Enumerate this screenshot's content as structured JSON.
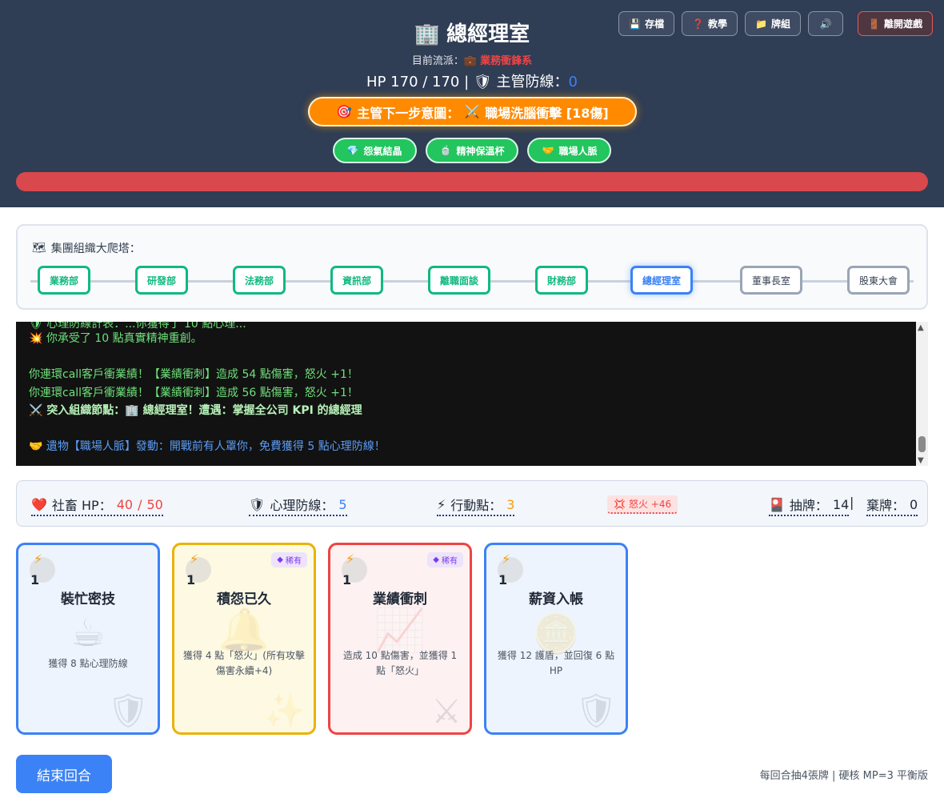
{
  "toolbar": {
    "save": {
      "icon": "💾",
      "label": "存檔"
    },
    "tutorial": {
      "icon": "❓",
      "label": "教學"
    },
    "deck": {
      "icon": "📁",
      "label": "牌組"
    },
    "sound": {
      "icon": "🔊"
    },
    "leave": {
      "icon": "🚪",
      "label": "離開遊戲"
    }
  },
  "enemy": {
    "icon": "🏢",
    "name": "總經理室",
    "faction_label": "目前流派：",
    "faction_icon": "💼",
    "faction_value": "業務衝鋒系",
    "hp_text": "HP 170 / 170 |",
    "shield_icon": "🛡",
    "defense_label": "主管防線：",
    "defense_value": "0",
    "hp_fraction": 1.0,
    "intent": {
      "icon": "🎯",
      "label": "主管下一步意圖：",
      "attack_icon": "⚔️",
      "value": "職場洗腦衝擊 [18傷]"
    },
    "relics": [
      {
        "icon": "💎",
        "label": "怨氣結晶"
      },
      {
        "icon": "🍵",
        "label": "精神保溫杯"
      },
      {
        "icon": "🤝",
        "label": "職場人脈"
      }
    ]
  },
  "map": {
    "icon": "🗺",
    "title": "集團組織大爬塔：",
    "nodes": [
      {
        "label": "業務部",
        "state": "cleared"
      },
      {
        "label": "研發部",
        "state": "cleared"
      },
      {
        "label": "法務部",
        "state": "cleared"
      },
      {
        "label": "資訊部",
        "state": "cleared"
      },
      {
        "label": "離職面談",
        "state": "cleared"
      },
      {
        "label": "財務部",
        "state": "cleared"
      },
      {
        "label": "總經理室",
        "state": "current"
      },
      {
        "label": "董事長室",
        "state": "locked"
      },
      {
        "label": "股東大會",
        "state": "locked"
      }
    ]
  },
  "log": {
    "partial_top": "🛡 心理防線計表：...你獲得了 10 點心理...",
    "lines": [
      {
        "icon": "💥",
        "text": "你承受了 10 點真實精神重創。"
      },
      {
        "icon": "",
        "text": "你連環call客戶衝業績！【業績衝刺】造成 54 點傷害，怒火 +1！"
      },
      {
        "icon": "",
        "text": "你連環call客戶衝業績！【業績衝刺】造成 56 點傷害，怒火 +1！"
      },
      {
        "icon": "⚔️",
        "text": "突入組織節點：🏢 總經理室！遭遇：掌握全公司 KPI 的總經理"
      },
      {
        "icon": "🤝",
        "text": "遺物【職場人脈】發動：開戰前有人罩你，免費獲得 5 點心理防線！"
      }
    ]
  },
  "player": {
    "hp": {
      "icon": "❤️",
      "label": "社畜 HP：",
      "current": "40",
      "sep": " / ",
      "max": "50"
    },
    "defense": {
      "icon": "🛡",
      "label": "心理防線：",
      "value": "5"
    },
    "action": {
      "icon": "⚡",
      "label": "行動點：",
      "value": "3"
    },
    "rage": {
      "icon": "💢",
      "label": "怒火 +46"
    },
    "draw": {
      "icon": "🎴",
      "label": "抽牌：",
      "value": "14"
    },
    "discard": {
      "label": "棄牌：",
      "value": "0"
    },
    "divider": "|"
  },
  "cards": [
    {
      "cost": "1",
      "name": "裝忙密技",
      "desc": "獲得 8 點心理防線",
      "rarity": "",
      "color": "blue",
      "art_icon": "☕",
      "bg_icon": "🛡"
    },
    {
      "cost": "1",
      "name": "積怨已久",
      "desc": "獲得 4 點「怒火」(所有攻擊傷害永續+4)",
      "rarity": "稀有",
      "color": "yellow",
      "art_icon": "🔔",
      "bg_icon": "✨"
    },
    {
      "cost": "1",
      "name": "業績衝刺",
      "desc": "造成 10 點傷害，並獲得 1 點「怒火」",
      "rarity": "稀有",
      "color": "red",
      "art_icon": "📈",
      "bg_icon": "⚔"
    },
    {
      "cost": "1",
      "name": "薪資入帳",
      "desc": "獲得 12 護盾，並回復 6 點 HP",
      "rarity": "",
      "color": "blue",
      "art_icon": "🪙",
      "bg_icon": "🛡"
    }
  ],
  "end_turn_label": "結束回合",
  "footer_note": "每回合抽4張牌 | 硬核 MP=3 平衡版",
  "colors": {
    "header_bg": "#2f3d55",
    "intent": "#ff8a00",
    "relic": "#22c55e",
    "enemy_hp": "#d9484c",
    "accent": "#3b82f6"
  }
}
